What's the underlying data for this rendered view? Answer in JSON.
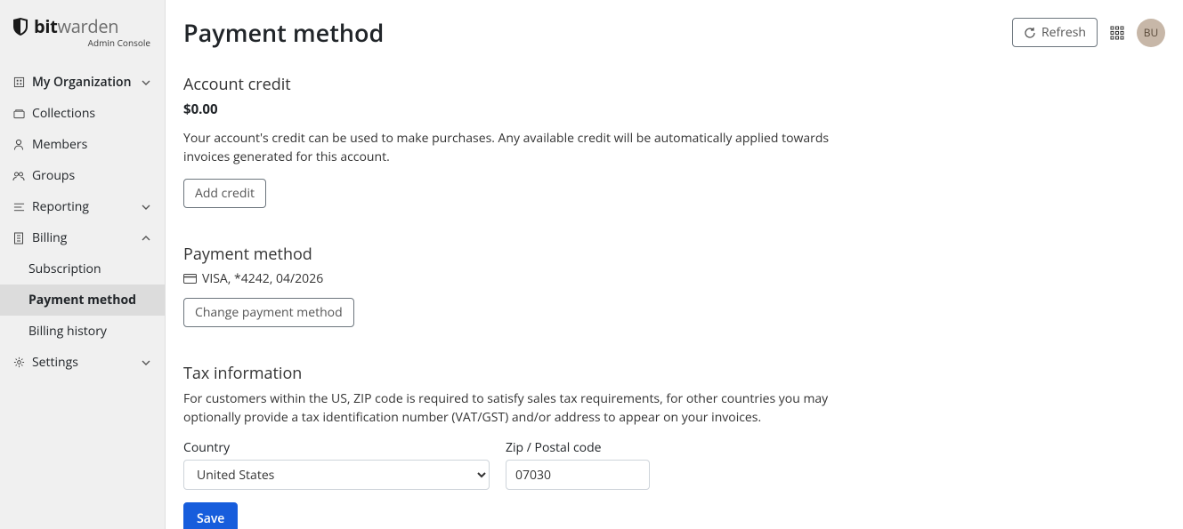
{
  "brand": {
    "name_bold": "bit",
    "name_light": "warden",
    "subtitle": "Admin Console"
  },
  "sidebar": {
    "items": [
      {
        "label": "My Organization",
        "icon": "building",
        "expandable": true,
        "state": "collapsed",
        "bold": true
      },
      {
        "label": "Collections",
        "icon": "collections"
      },
      {
        "label": "Members",
        "icon": "person"
      },
      {
        "label": "Groups",
        "icon": "groups"
      },
      {
        "label": "Reporting",
        "icon": "reporting",
        "expandable": true,
        "state": "collapsed"
      },
      {
        "label": "Billing",
        "icon": "billing",
        "expandable": true,
        "state": "expanded"
      },
      {
        "label": "Settings",
        "icon": "gear",
        "expandable": true,
        "state": "collapsed"
      }
    ],
    "billing_sub": [
      {
        "label": "Subscription",
        "active": false
      },
      {
        "label": "Payment method",
        "active": true
      },
      {
        "label": "Billing history",
        "active": false
      }
    ]
  },
  "header": {
    "title": "Payment method",
    "refresh_label": "Refresh",
    "avatar_initials": "BU"
  },
  "account_credit": {
    "title": "Account credit",
    "amount": "$0.00",
    "description": "Your account's credit can be used to make purchases. Any available credit will be automatically applied towards invoices generated for this account.",
    "add_button": "Add credit"
  },
  "payment_method": {
    "title": "Payment method",
    "card_summary": "VISA, *4242, 04/2026",
    "change_button": "Change payment method"
  },
  "tax": {
    "title": "Tax information",
    "description": "For customers within the US, ZIP code is required to satisfy sales tax requirements, for other countries you may optionally provide a tax identification number (VAT/GST) and/or address to appear on your invoices.",
    "country_label": "Country",
    "country_value": "United States",
    "zip_label": "Zip / Postal code",
    "zip_value": "07030",
    "save_button": "Save"
  }
}
